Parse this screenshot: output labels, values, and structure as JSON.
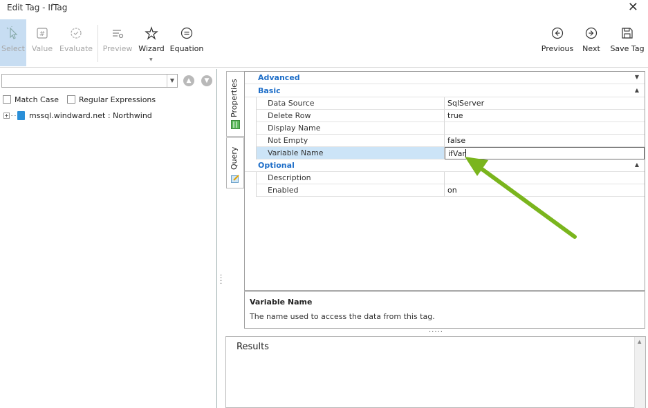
{
  "window": {
    "title": "Edit Tag - IfTag",
    "close_glyph": "✕"
  },
  "ribbon": {
    "select": "Select",
    "value": "Value",
    "evaluate": "Evaluate",
    "preview": "Preview",
    "wizard": "Wizard",
    "equation": "Equation",
    "previous": "Previous",
    "next": "Next",
    "save_tag": "Save Tag"
  },
  "left": {
    "search_value": "",
    "match_case": "Match Case",
    "regular_expressions": "Regular Expressions",
    "tree_item": "mssql.windward.net : Northwind"
  },
  "tabs": {
    "properties": "Properties",
    "query": "Query"
  },
  "grid": {
    "advanced": "Advanced",
    "basic": "Basic",
    "optional": "Optional",
    "basic_rows": [
      {
        "name": "Data Source",
        "value": "SqlServer"
      },
      {
        "name": "Delete Row",
        "value": "true"
      },
      {
        "name": "Display Name",
        "value": ""
      },
      {
        "name": "Not Empty",
        "value": "false"
      },
      {
        "name": "Variable Name",
        "value": "ifVar"
      }
    ],
    "optional_rows": [
      {
        "name": "Description",
        "value": ""
      },
      {
        "name": "Enabled",
        "value": "on"
      }
    ]
  },
  "description": {
    "title": "Variable Name",
    "text": "The name used to access the data from this tag."
  },
  "results": {
    "label": "Results"
  },
  "colors": {
    "accent": "#1e6ec8",
    "arrow": "#7ab51d",
    "selected": "#c7ddf2"
  }
}
